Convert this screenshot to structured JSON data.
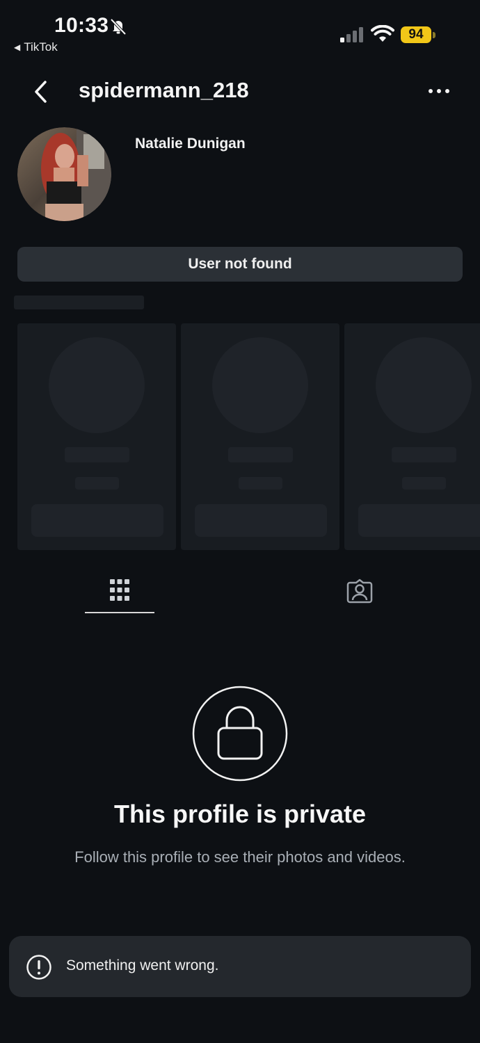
{
  "status_bar": {
    "time": "10:33",
    "back_app": "TikTok",
    "battery": "94",
    "icons": [
      "bell-slash-icon",
      "signal-icon",
      "wifi-icon",
      "battery-icon"
    ],
    "battery_color": "#f2c718"
  },
  "header": {
    "username": "spidermann_218",
    "icons": [
      "chevron-left-icon",
      "more-icon"
    ]
  },
  "profile": {
    "display_name": "Natalie Dunigan",
    "status_button": "User not found"
  },
  "tabs": [
    {
      "name": "posts",
      "icon": "grid-icon",
      "selected": true
    },
    {
      "name": "tagged",
      "icon": "tagged-person-icon",
      "selected": false
    }
  ],
  "private": {
    "title": "This profile is private",
    "subtitle": "Follow this profile to see their photos and videos.",
    "icon": "lock-icon"
  },
  "toast": {
    "message": "Something went wrong.",
    "icon": "exclamation-circle-icon"
  },
  "colors": {
    "background": "#0d1014",
    "button": "#2b3036",
    "toast": "#24282d",
    "muted_text": "#a9afb6"
  }
}
